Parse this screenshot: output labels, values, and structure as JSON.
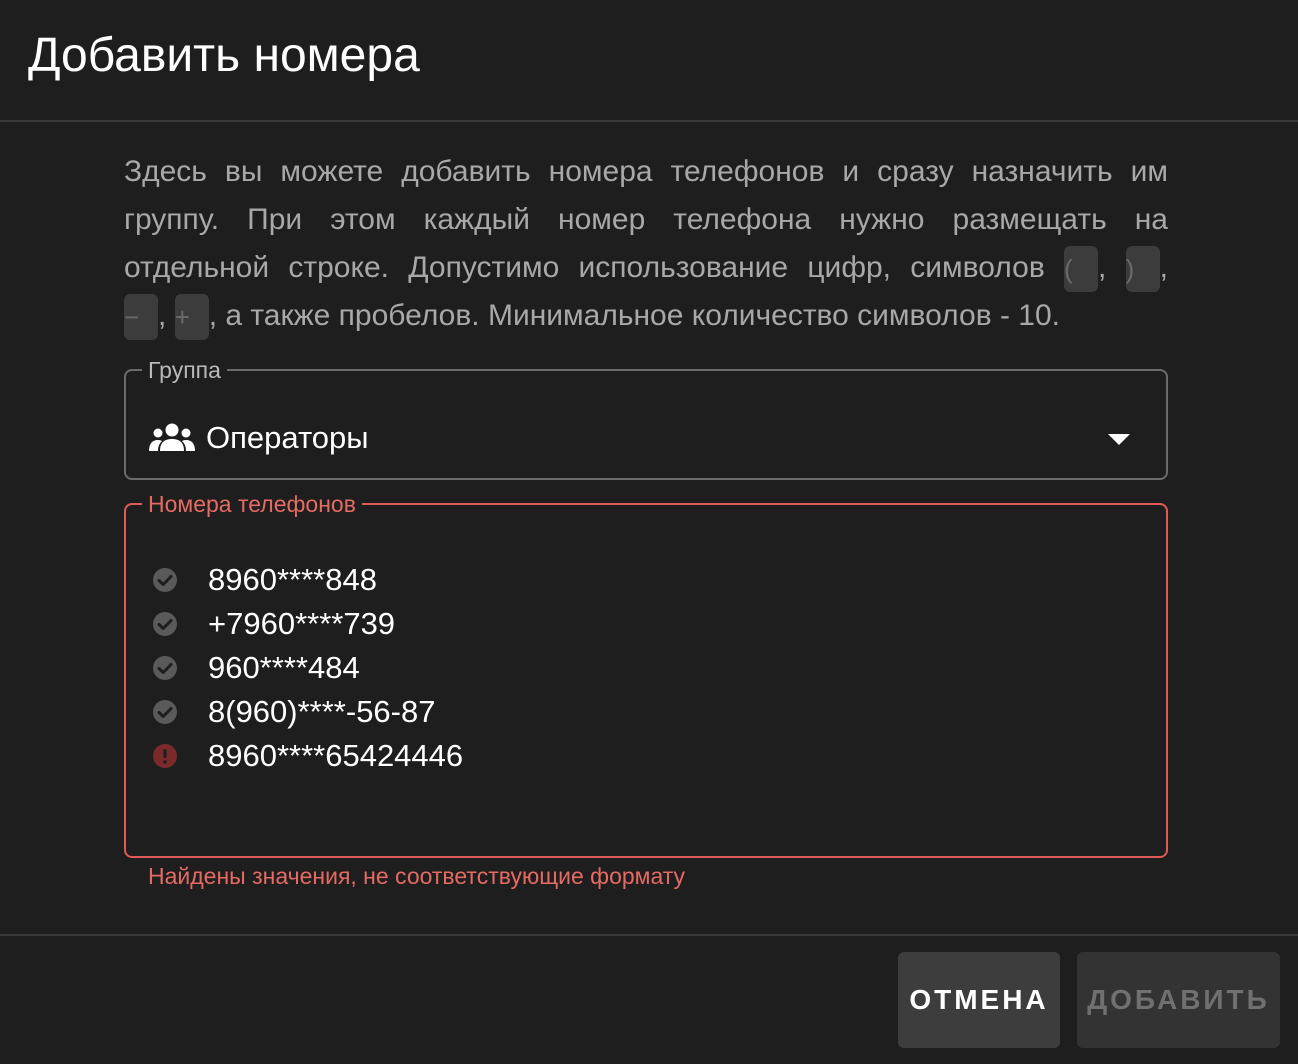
{
  "dialog": {
    "title": "Добавить номера"
  },
  "description": {
    "line1": "Здесь вы можете добавить номера телефонов и сразу назначить им",
    "line2": "группу. При этом каждый номер телефона нужно размещать на",
    "line3_prefix": "отдельной строке. Допустимо использование цифр, символов",
    "line4_suffix": ", а также пробелов. Минимальное количество символов - 10.",
    "chips": [
      "(",
      ")",
      "−",
      "+"
    ],
    "separator": ","
  },
  "group_field": {
    "label": "Группа",
    "value": "Операторы",
    "icon": "people-icon"
  },
  "phones_field": {
    "label": "Номера телефонов",
    "items": [
      {
        "number": "8960****848",
        "status": "valid",
        "icon": "check-circle-icon"
      },
      {
        "number": "+7960****739",
        "status": "valid",
        "icon": "check-circle-icon"
      },
      {
        "number": "960****484",
        "status": "valid",
        "icon": "check-circle-icon"
      },
      {
        "number": "8(960)****-56-87",
        "status": "valid",
        "icon": "check-circle-icon"
      },
      {
        "number": "8960****65424446",
        "status": "error",
        "icon": "error-circle-icon"
      }
    ],
    "helper_text": "Найдены значения, не соответствующие формату"
  },
  "actions": {
    "cancel_label": "ОТМЕНА",
    "add_label": "ДОБАВИТЬ"
  },
  "colors": {
    "background": "#1e1e1e",
    "error": "#e15a55",
    "muted_text": "#a8a8a8",
    "chip_bg": "#3c3c3c"
  }
}
